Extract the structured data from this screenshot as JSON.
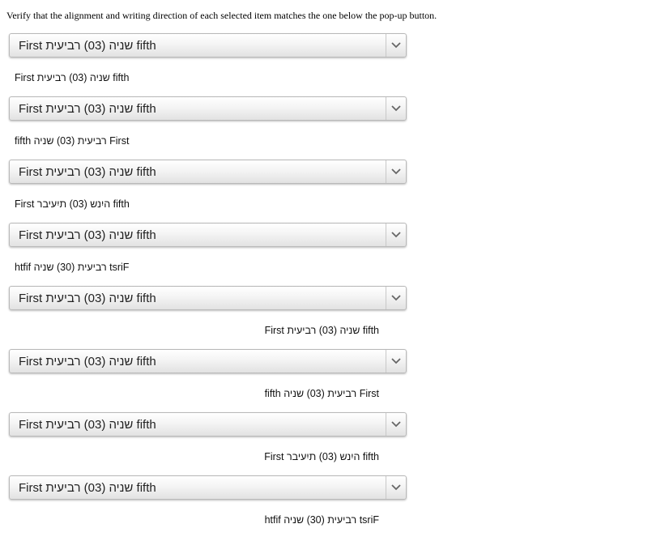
{
  "instructions": "Verify that the alignment and writing direction of each selected item matches the one below the pop-up button.",
  "rows": [
    {
      "select_value": "First שניה (03) רביעית fifth",
      "reference": "First שניה (03) רביעית fifth"
    },
    {
      "select_value": "First שניה (03) רביעית fifth",
      "reference": "fifth רביעית (03) שניה First"
    },
    {
      "select_value": "First שניה (03) רביעית fifth",
      "reference": "First היִנש (03) תיִעיבר fifth"
    },
    {
      "select_value": "First שניה (03) רביעית fifth",
      "reference": "htfif רביעית (30) שניה tsriF"
    },
    {
      "select_value": "First שניה (03) רביעית fifth",
      "reference": "First שניה (03) רביעית fifth"
    },
    {
      "select_value": "First שניה (03) רביעית fifth",
      "reference": "fifth רביעית (03) שניה First"
    },
    {
      "select_value": "First שניה (03) רביעית fifth",
      "reference": "First היִנש (03) תיִעיבר fifth"
    },
    {
      "select_value": "First שניה (03) רביעית fifth",
      "reference": "htfif רביעית (30) שניה tsriF"
    }
  ],
  "icons": {
    "select_arrow": "chevron-down-icon"
  },
  "colors": {
    "text": "#222222",
    "border": "#b9b9b9",
    "arrow": "#666666"
  }
}
